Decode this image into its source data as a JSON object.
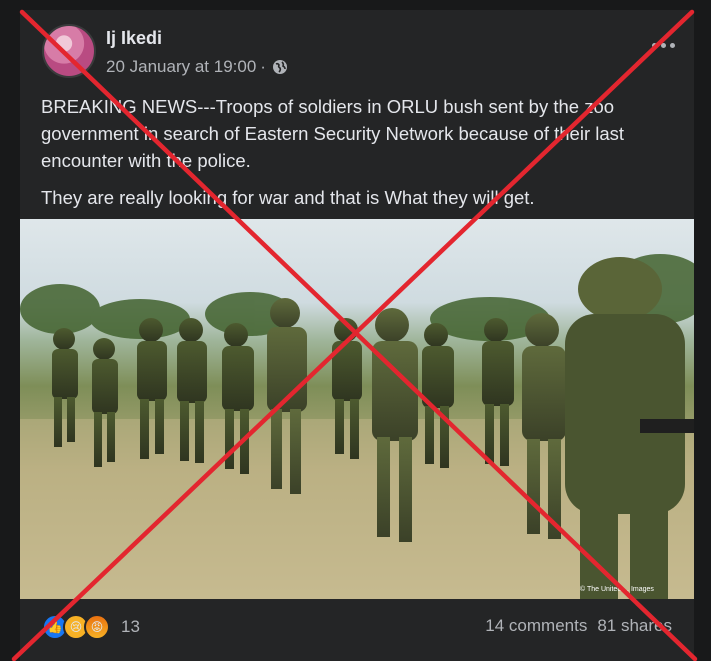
{
  "post": {
    "author": "Ij Ikedi",
    "timestamp": "20 January at 19:00",
    "separator": "·",
    "privacy_icon": "globe-icon",
    "more_icon": "more-options-icon",
    "paragraphs": [
      "BREAKING NEWS---Troops of soldiers in ORLU  bush sent by the zoo government in search of Eastern Security Network because of their last encounter with the police.",
      "They are really looking for war and that is What they will get."
    ],
    "image_credit": "© The United ... Images"
  },
  "engagement": {
    "reaction_icons": [
      "like-icon",
      "sad-icon",
      "angry-icon"
    ],
    "reaction_count": "13",
    "comments": "14 comments",
    "shares": "81 shares"
  },
  "overlay": {
    "type": "false-claim-cross",
    "color": "#e3262f"
  },
  "colors": {
    "background": "#18191a",
    "card": "#242526",
    "primary_text": "#e4e6eb",
    "secondary_text": "#b0b3b8",
    "like_blue": "#1877f2"
  }
}
